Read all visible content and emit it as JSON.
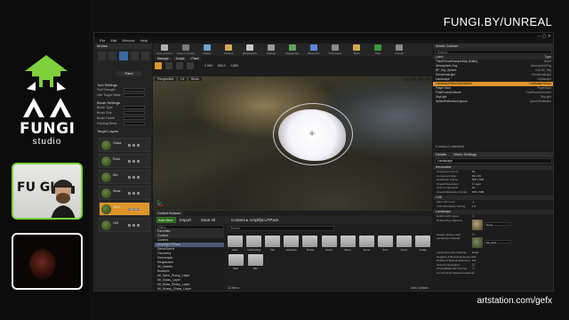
{
  "branding": {
    "site_top": "FUNGI.BY/UNREAL",
    "site_bottom": "artstation.com/gefx",
    "logo_word": "FUNGI",
    "logo_sub": "studio",
    "webcam_sign": "FU GI"
  },
  "editor": {
    "menu": [
      "File",
      "Edit",
      "Window",
      "Help"
    ],
    "modes": {
      "header": "Modes",
      "active_tool": "Paint",
      "sections": {
        "tool_settings": "Tool Settings",
        "brush_settings": "Brush Settings",
        "target_layers": "Target Layers"
      },
      "rows": [
        {
          "label": "Tool Strength",
          "value": ""
        },
        {
          "label": "Use Target Value",
          "value": ""
        },
        {
          "label": "Brush Type",
          "value": ""
        },
        {
          "label": "Brush Size",
          "value": ""
        },
        {
          "label": "Brush Falloff",
          "value": ""
        },
        {
          "label": "Painting Restr.",
          "value": ""
        }
      ],
      "layers": [
        "Grass",
        "Rock",
        "Dirt",
        "Moss",
        "Sand",
        "Cliff"
      ]
    },
    "toolbar": [
      {
        "label": "Save Current",
        "color": "#b0b0b0"
      },
      {
        "label": "Source Control",
        "color": "#7a7a7a"
      },
      {
        "label": "Modes",
        "color": "#6aa6d8"
      },
      {
        "label": "Content",
        "color": "#d8a85a"
      },
      {
        "label": "Marketplace",
        "color": "#c8c8c8"
      },
      {
        "label": "Settings",
        "color": "#9a9a9a"
      },
      {
        "label": "Megascans",
        "color": "#5aa85a"
      },
      {
        "label": "Blueprints",
        "color": "#5a8ad8"
      },
      {
        "label": "Cinematics",
        "color": "#8a8a8a"
      },
      {
        "label": "Build",
        "color": "#d8a850"
      },
      {
        "label": "Play",
        "color": "#3a9a3a"
      },
      {
        "label": "Launch",
        "color": "#8a8a8a"
      }
    ],
    "tool_strip": {
      "tabs": [
        "Manage",
        "Sculpt",
        "Paint"
      ],
      "nums": [
        "0.300",
        "600.0",
        "0.500"
      ]
    },
    "viewport": {
      "controls": [
        "Perspective",
        "Lit",
        "Show"
      ],
      "brush_shape": "circle"
    },
    "content_browser": {
      "tab": "Content Browser",
      "add_new": "Add New",
      "import": "Import",
      "save_all": "Save All",
      "path": [
        "Content",
        "AmplifyLUTPack"
      ],
      "filters_placeholder": "Filters",
      "search_placeholder": "Search",
      "tree": [
        {
          "label": "Favorites",
          "type": "hdr"
        },
        {
          "label": "Content",
          "type": "hdr"
        },
        {
          "label": "Content",
          "type": "item"
        },
        {
          "label": "AmplifyLUTPack",
          "type": "sel"
        },
        {
          "label": "DemoScene",
          "type": "item"
        },
        {
          "label": "Geometry",
          "type": "item"
        },
        {
          "label": "Mannequin",
          "type": "item"
        },
        {
          "label": "Megascans",
          "type": "item"
        },
        {
          "label": "3D_Assets",
          "type": "item"
        },
        {
          "label": "Surfaces",
          "type": "item"
        },
        {
          "label": "MI_Sand_Rocky_Layer",
          "type": "item"
        },
        {
          "label": "MI_Grass_Layer",
          "type": "item"
        },
        {
          "label": "MI_Moss_Rocky_Layer",
          "type": "item"
        },
        {
          "label": "MI_Mossy_Grass_Layer",
          "type": "item"
        }
      ],
      "folders": [
        "Basic",
        "ColorGrading",
        "Film",
        "Landscape",
        "Portrait",
        "Roads",
        "Nature",
        "Scene",
        "Sci-fi",
        "Sunset",
        "Vintage",
        "Wide",
        "Wild"
      ],
      "item_count": "13 items",
      "view_options": "View Options"
    },
    "outliner": {
      "tab": "World Outliner",
      "search_placeholder": "Search...",
      "col_label": "Label",
      "col_type": "Type",
      "rows": [
        {
          "label": "ThirdPersonExampleMap (Editor)",
          "type": "World",
          "sel": false
        },
        {
          "label": "Atmospheric Fog",
          "type": "AtmosphericFog",
          "sel": false
        },
        {
          "label": "BP_Sky_Sphere",
          "type": "Edit BP_Sky",
          "sel": false
        },
        {
          "label": "DirectionalLight",
          "type": "DirectionalLight",
          "sel": false
        },
        {
          "label": "Landscape",
          "type": "Landscape",
          "sel": false
        },
        {
          "label": "LandscapeGizmoActiveActor",
          "type": "LandscapeGizmo",
          "sel": true
        },
        {
          "label": "Player Start",
          "type": "PlayerStart",
          "sel": false
        },
        {
          "label": "PostProcessVolume",
          "type": "PostProcessVolume",
          "sel": false
        },
        {
          "label": "SkyLight",
          "type": "SkyLight",
          "sel": false
        },
        {
          "label": "SphereReflectionCapture",
          "type": "SphereReflection",
          "sel": false
        }
      ],
      "status": "9 actors (1 selected)",
      "view_options": "View Options"
    },
    "details": {
      "tabs": [
        "Details",
        "World Settings"
      ],
      "name_field": "Landscape",
      "sections": {
        "info": "Information",
        "lod": "LOD",
        "landscape": "Landscape"
      },
      "info_rows": [
        {
          "label": "Component Count",
          "value": "64"
        },
        {
          "label": "Component Size",
          "value": "63 x 63"
        },
        {
          "label": "Resolution (Verts)",
          "value": "505 x 505"
        },
        {
          "label": "Overall Resolution",
          "value": "1 Layer"
        },
        {
          "label": "Total Components",
          "value": "64"
        },
        {
          "label": "Overall Resolution (Verts)",
          "value": "505 x 505"
        }
      ],
      "lod_rows": [
        {
          "label": "Max LOD Level",
          "value": "-1"
        },
        {
          "label": "LOD Distribution Setting",
          "value": "1.0"
        }
      ],
      "landscape_rows": [
        {
          "label": "Enable Edit Layers",
          "value": ""
        },
        {
          "label": "Default Phys Material",
          "value": "None"
        },
        {
          "label": "Stream Texture Grid",
          "value": ""
        },
        {
          "label": "Landscape Material",
          "value": "MI_LAN"
        },
        {
          "label": "Landscape Hole Material",
          "value": "None"
        },
        {
          "label": "Negative Z Bounds Extension",
          "value": "0.0"
        },
        {
          "label": "Positive Z Bounds Extension",
          "value": "0.0"
        },
        {
          "label": "Used for Navigation",
          "value": ""
        },
        {
          "label": "PhysicalMaterial Override",
          "value": ""
        },
        {
          "label": "Use Dynamic Material Instance",
          "value": ""
        }
      ]
    }
  }
}
